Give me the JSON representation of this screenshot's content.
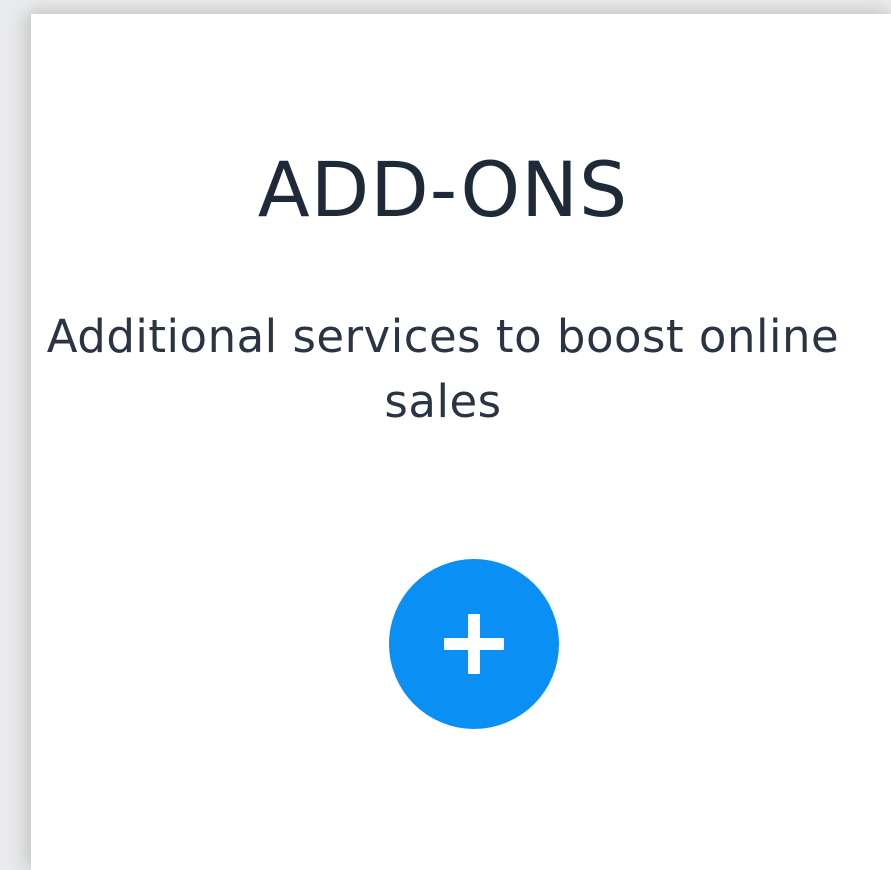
{
  "card": {
    "title": "ADD-ONS",
    "subtitle": "Additional services to boost online sales"
  },
  "add_button": {
    "icon": "plus-icon",
    "color": "#0a8ff5"
  },
  "colors": {
    "title": "#1f2a38",
    "subtitle": "#2a3442",
    "card_background": "#ffffff",
    "page_background": "#e9eaeb"
  }
}
